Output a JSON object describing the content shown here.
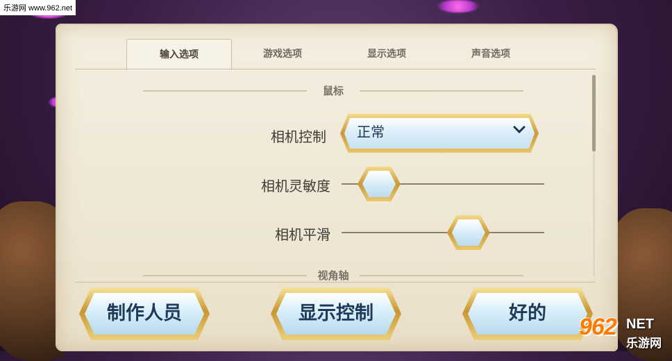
{
  "watermark": {
    "top_left": "乐游网 www.962.net",
    "corner_number": "962",
    "corner_net": "NET",
    "corner_cn": "乐游网"
  },
  "tabs": [
    {
      "label": "输入选项",
      "active": true
    },
    {
      "label": "游戏选项",
      "active": false
    },
    {
      "label": "显示选项",
      "active": false
    },
    {
      "label": "声音选项",
      "active": false
    }
  ],
  "sections": {
    "mouse": "鼠标",
    "view_axis": "视角轴"
  },
  "settings": {
    "camera_control": {
      "label": "相机控制",
      "value": "正常",
      "icon": "chevron-down-icon"
    },
    "camera_sensitivity": {
      "label": "相机灵敏度",
      "level": 0.1
    },
    "camera_smoothing": {
      "label": "相机平滑",
      "level": 0.66
    }
  },
  "buttons": {
    "credits": "制作人员",
    "display_control": "显示控制",
    "ok": "好的"
  },
  "colors": {
    "parchment": "#f0e8d6",
    "gold": "#d4a94a",
    "button_blue": "#cfe7f5",
    "text_dark": "#1f3a58"
  }
}
